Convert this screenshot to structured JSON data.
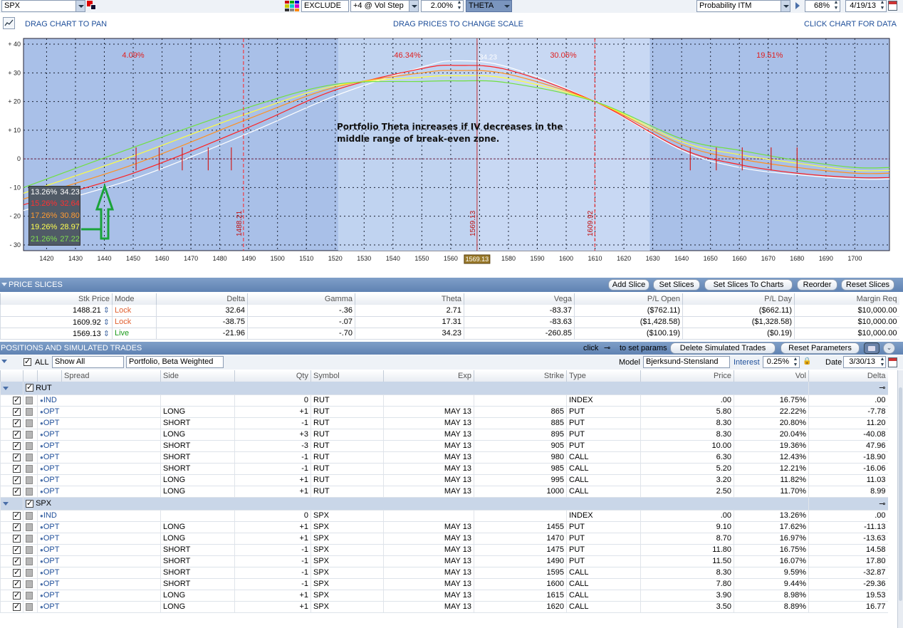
{
  "toolbar": {
    "symbol": "SPX",
    "exclude": "EXCLUDE",
    "vol_step": "+4 @ Vol Step",
    "step_pct": "2.00%",
    "metric": "THETA",
    "prob": "Probability ITM",
    "prob_pct": "68%",
    "date": "4/19/13"
  },
  "chart_header": {
    "pan": "DRAG CHART TO PAN",
    "scale": "DRAG PRICES TO CHANGE SCALE",
    "click": "CLICK CHART FOR DATA"
  },
  "chart_data": {
    "type": "line",
    "x_range": [
      1412,
      1712
    ],
    "y_range": [
      -32,
      42
    ],
    "x_ticks": [
      1420,
      1430,
      1440,
      1450,
      1460,
      1470,
      1480,
      1490,
      1500,
      1510,
      1520,
      1530,
      1540,
      1550,
      1560,
      1570,
      1580,
      1590,
      1600,
      1610,
      1620,
      1630,
      1640,
      1650,
      1660,
      1670,
      1680,
      1690,
      1700
    ],
    "y_ticks": [
      {
        "v": 40,
        "t": "+ 40"
      },
      {
        "v": 30,
        "t": "+ 30"
      },
      {
        "v": 20,
        "t": "+ 20"
      },
      {
        "v": 10,
        "t": "+ 10"
      },
      {
        "v": 0,
        "t": "0"
      },
      {
        "v": -10,
        "t": "- 10"
      },
      {
        "v": -20,
        "t": "- 20"
      },
      {
        "v": -30,
        "t": "- 30"
      }
    ],
    "zones": [
      {
        "from": 1412,
        "to": 1488,
        "label": "4.09%"
      },
      {
        "from": 1521,
        "to": 1569,
        "label": "46.34%"
      },
      {
        "from": 1569,
        "to": 1629,
        "label": "30.06%"
      },
      {
        "from": 1629,
        "to": 1712,
        "label": "19.51%"
      }
    ],
    "slice_lines": [
      {
        "x": 1488.21,
        "label": "1488.21"
      },
      {
        "x": 1569.13,
        "label": "1569.13"
      },
      {
        "x": 1609.92,
        "label": "1609.92"
      }
    ],
    "cursor_label": "1569.13",
    "peak_label": "34.23",
    "annotation": [
      "Portfolio Theta increases if IV decreases in the",
      "middle range of break-even zone."
    ],
    "series": [
      {
        "name": "13.26%",
        "color": "#ffffff",
        "display": "34.23",
        "points": [
          [
            1412,
            -18
          ],
          [
            1450,
            -7
          ],
          [
            1490,
            9
          ],
          [
            1520,
            22
          ],
          [
            1550,
            32
          ],
          [
            1562,
            34.2
          ],
          [
            1580,
            32
          ],
          [
            1609.9,
            20
          ],
          [
            1640,
            3
          ],
          [
            1660,
            -3
          ],
          [
            1680,
            -5.5
          ],
          [
            1700,
            -7
          ],
          [
            1712,
            -7
          ]
        ]
      },
      {
        "name": "15.26%",
        "color": "#ff2020",
        "display": "32.64",
        "points": [
          [
            1412,
            -16
          ],
          [
            1450,
            -5
          ],
          [
            1490,
            11
          ],
          [
            1520,
            24
          ],
          [
            1550,
            31.5
          ],
          [
            1562,
            32.6
          ],
          [
            1580,
            31
          ],
          [
            1609.9,
            20
          ],
          [
            1640,
            3.5
          ],
          [
            1660,
            -2
          ],
          [
            1680,
            -5
          ],
          [
            1700,
            -6.5
          ],
          [
            1712,
            -6.5
          ]
        ]
      },
      {
        "name": "17.26%",
        "color": "#ff9020",
        "display": "30.80",
        "points": [
          [
            1412,
            -14
          ],
          [
            1450,
            -2
          ],
          [
            1490,
            14
          ],
          [
            1520,
            25
          ],
          [
            1550,
            30
          ],
          [
            1562,
            30.8
          ],
          [
            1580,
            29.5
          ],
          [
            1609.9,
            20
          ],
          [
            1640,
            5
          ],
          [
            1660,
            0
          ],
          [
            1680,
            -3
          ],
          [
            1700,
            -5
          ],
          [
            1712,
            -5
          ]
        ]
      },
      {
        "name": "19.26%",
        "color": "#ffff40",
        "display": "28.97",
        "points": [
          [
            1412,
            -12
          ],
          [
            1450,
            1
          ],
          [
            1490,
            16
          ],
          [
            1520,
            25.5
          ],
          [
            1550,
            28.5
          ],
          [
            1562,
            29
          ],
          [
            1580,
            28
          ],
          [
            1609.9,
            20
          ],
          [
            1640,
            6
          ],
          [
            1660,
            1.5
          ],
          [
            1680,
            -1.5
          ],
          [
            1700,
            -4
          ],
          [
            1712,
            -4
          ]
        ]
      },
      {
        "name": "21.26%",
        "color": "#70e040",
        "display": "27.22",
        "points": [
          [
            1412,
            -10
          ],
          [
            1450,
            4
          ],
          [
            1490,
            18
          ],
          [
            1520,
            26
          ],
          [
            1550,
            27
          ],
          [
            1562,
            27.2
          ],
          [
            1580,
            26.5
          ],
          [
            1609.9,
            20
          ],
          [
            1640,
            7
          ],
          [
            1660,
            3
          ],
          [
            1680,
            -0.5
          ],
          [
            1700,
            -3
          ],
          [
            1712,
            -3
          ]
        ]
      }
    ]
  },
  "price_slices": {
    "title": "PRICE SLICES",
    "buttons": [
      "Add Slice",
      "Set Slices",
      "Set Slices To Charts",
      "Reorder",
      "Reset Slices"
    ],
    "headers": [
      "Stk Price",
      "Mode",
      "Delta",
      "Gamma",
      "Theta",
      "Vega",
      "P/L Open",
      "P/L Day",
      "Margin Req"
    ],
    "rows": [
      [
        "1488.21",
        "Lock",
        "32.64",
        "-.36",
        "2.71",
        "-83.37",
        "($762.11)",
        "($662.11)",
        "$10,000.00"
      ],
      [
        "1609.92",
        "Lock",
        "-38.75",
        "-.07",
        "17.31",
        "-83.63",
        "($1,428.58)",
        "($1,328.58)",
        "$10,000.00"
      ],
      [
        "1569.13",
        "Live",
        "-21.96",
        "-.70",
        "34.23",
        "-260.85",
        "($100.19)",
        "($0.19)",
        "$10,000.00"
      ]
    ]
  },
  "positions": {
    "title": "POSITIONS AND SIMULATED TRADES",
    "click_text": "click",
    "set_params": "to set params",
    "delete_btn": "Delete Simulated Trades",
    "reset_btn": "Reset Parameters",
    "all": "ALL",
    "show": "Show All",
    "portfolio": "Portfolio, Beta Weighted",
    "model_label": "Model",
    "model": "Bjerksund-Stensland",
    "interest_label": "Interest",
    "interest": "0.25%",
    "date_label": "Date",
    "date": "3/30/13",
    "headers": [
      "Spread",
      "Side",
      "Qty",
      "Symbol",
      "Exp",
      "Strike",
      "Type",
      "Price",
      "Vol",
      "Delta"
    ],
    "groups": [
      {
        "name": "RUT",
        "rows": [
          [
            "IND",
            "",
            "0",
            "RUT",
            "",
            "",
            "INDEX",
            ".00",
            "16.75%",
            ".00"
          ],
          [
            "OPT",
            "LONG",
            "+1",
            "RUT",
            "MAY 13",
            "865",
            "PUT",
            "5.80",
            "22.22%",
            "-7.78"
          ],
          [
            "OPT",
            "SHORT",
            "-1",
            "RUT",
            "MAY 13",
            "885",
            "PUT",
            "8.30",
            "20.80%",
            "11.20"
          ],
          [
            "OPT",
            "LONG",
            "+3",
            "RUT",
            "MAY 13",
            "895",
            "PUT",
            "8.30",
            "20.04%",
            "-40.08"
          ],
          [
            "OPT",
            "SHORT",
            "-3",
            "RUT",
            "MAY 13",
            "905",
            "PUT",
            "10.00",
            "19.36%",
            "47.96"
          ],
          [
            "OPT",
            "SHORT",
            "-1",
            "RUT",
            "MAY 13",
            "980",
            "CALL",
            "6.30",
            "12.43%",
            "-18.90"
          ],
          [
            "OPT",
            "SHORT",
            "-1",
            "RUT",
            "MAY 13",
            "985",
            "CALL",
            "5.20",
            "12.21%",
            "-16.06"
          ],
          [
            "OPT",
            "LONG",
            "+1",
            "RUT",
            "MAY 13",
            "995",
            "CALL",
            "3.20",
            "11.82%",
            "11.03"
          ],
          [
            "OPT",
            "LONG",
            "+1",
            "RUT",
            "MAY 13",
            "1000",
            "CALL",
            "2.50",
            "11.70%",
            "8.99"
          ]
        ]
      },
      {
        "name": "SPX",
        "rows": [
          [
            "IND",
            "",
            "0",
            "SPX",
            "",
            "",
            "INDEX",
            ".00",
            "13.26%",
            ".00"
          ],
          [
            "OPT",
            "LONG",
            "+1",
            "SPX",
            "MAY 13",
            "1455",
            "PUT",
            "9.10",
            "17.62%",
            "-11.13"
          ],
          [
            "OPT",
            "LONG",
            "+1",
            "SPX",
            "MAY 13",
            "1470",
            "PUT",
            "8.70",
            "16.97%",
            "-13.63"
          ],
          [
            "OPT",
            "SHORT",
            "-1",
            "SPX",
            "MAY 13",
            "1475",
            "PUT",
            "11.80",
            "16.75%",
            "14.58"
          ],
          [
            "OPT",
            "SHORT",
            "-1",
            "SPX",
            "MAY 13",
            "1490",
            "PUT",
            "11.50",
            "16.07%",
            "17.80"
          ],
          [
            "OPT",
            "SHORT",
            "-1",
            "SPX",
            "MAY 13",
            "1595",
            "CALL",
            "8.30",
            "9.59%",
            "-32.87"
          ],
          [
            "OPT",
            "SHORT",
            "-1",
            "SPX",
            "MAY 13",
            "1600",
            "CALL",
            "7.80",
            "9.44%",
            "-29.36"
          ],
          [
            "OPT",
            "LONG",
            "+1",
            "SPX",
            "MAY 13",
            "1615",
            "CALL",
            "3.90",
            "8.98%",
            "19.53"
          ],
          [
            "OPT",
            "LONG",
            "+1",
            "SPX",
            "MAY 13",
            "1620",
            "CALL",
            "3.50",
            "8.89%",
            "16.77"
          ]
        ]
      }
    ]
  }
}
